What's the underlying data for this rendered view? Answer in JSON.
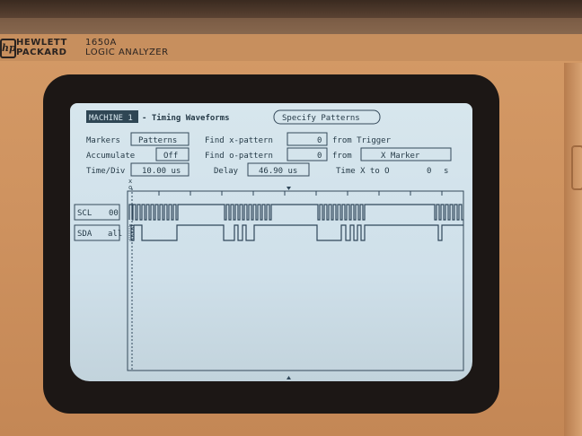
{
  "bezel": {
    "brand_line1": "HEWLETT",
    "brand_line2": "PACKARD",
    "model_number": "1650A",
    "model_name": "LOGIC ANALYZER"
  },
  "header": {
    "machine": "MACHINE 1",
    "title": "- Timing Waveforms",
    "specify_button": "Specify Patterns"
  },
  "controls": {
    "markers_label": "Markers",
    "markers_value": "Patterns",
    "accumulate_label": "Accumulate",
    "accumulate_value": "Off",
    "timediv_label": "Time/Div",
    "timediv_value": "10.00 us",
    "find_x_label": "Find x-pattern",
    "find_x_value": "0",
    "find_x_from": "from Trigger",
    "find_o_label": "Find o-pattern",
    "find_o_value": "0",
    "find_o_from_label": "from",
    "find_o_from_value": "X Marker",
    "delay_label": "Delay",
    "delay_value": "46.90 us",
    "time_label": "Time X to O",
    "time_value": "0",
    "time_unit": "s"
  },
  "markers": {
    "x": "x",
    "o": "o"
  },
  "channels": [
    {
      "name": "SCL",
      "value": "00"
    },
    {
      "name": "SDA",
      "value": "all"
    }
  ]
}
